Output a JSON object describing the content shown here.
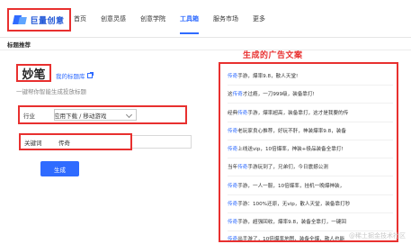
{
  "nav": {
    "logo_text": "巨量创意",
    "items": [
      {
        "label": "首页"
      },
      {
        "label": "创意灵感"
      },
      {
        "label": "创意学院"
      },
      {
        "label": "工具箱",
        "active": true
      },
      {
        "label": "服务市场"
      },
      {
        "label": "更多"
      }
    ]
  },
  "section_title": "标题推荐",
  "brand": {
    "name": "妙笔",
    "library_link": "我的标题库",
    "subtitle": "一键帮你智能生成投放标题"
  },
  "form": {
    "industry_label": "行业",
    "industry_value": "应用下载 / 移动游戏",
    "keyword_label": "关键词",
    "keyword_value": "传奇",
    "generate_button": "生成"
  },
  "results": {
    "title": "生成的广告文案",
    "highlight_keyword": "传奇",
    "items": [
      {
        "keyword": "传奇",
        "text": "手游，爆率9.8，散人天堂!"
      },
      {
        "prefix": "这",
        "keyword": "传奇",
        "text": "才过瘾，一刀999级，装备靠打!"
      },
      {
        "prefix": "经典",
        "keyword": "传奇",
        "text": "手游，爆率超高，装备靠打，这才是我要的传"
      },
      {
        "keyword": "传奇",
        "text": "老玩家良心推荐，好玩不肝，神装爆率9.8，装备"
      },
      {
        "keyword": "传奇",
        "text": "上线送vip，10倍爆率，神装+极品装备全靠打!"
      },
      {
        "prefix": "当年",
        "keyword": "传奇",
        "text": "手游玩到了，兄弟们，今日震撼公测"
      },
      {
        "keyword": "传奇",
        "text": "手游，一人一服，10倍爆率，挂机一晚爆神装，"
      },
      {
        "keyword": "传奇",
        "text": "手游：100%还原，无vip，散人天堂，装备靠打秒"
      },
      {
        "keyword": "传奇",
        "text": "手游，超强回收，爆率9.8，装备全靠打，一键回"
      },
      {
        "keyword": "传奇",
        "text": "出手游了，10倍爆率地图，装备全爆，散人也能"
      }
    ]
  },
  "watermark": "@稀土掘金技术社区",
  "colors": {
    "accent": "#2f6bff",
    "highlight_border": "#e8302f",
    "title_red": "#e8302f"
  }
}
